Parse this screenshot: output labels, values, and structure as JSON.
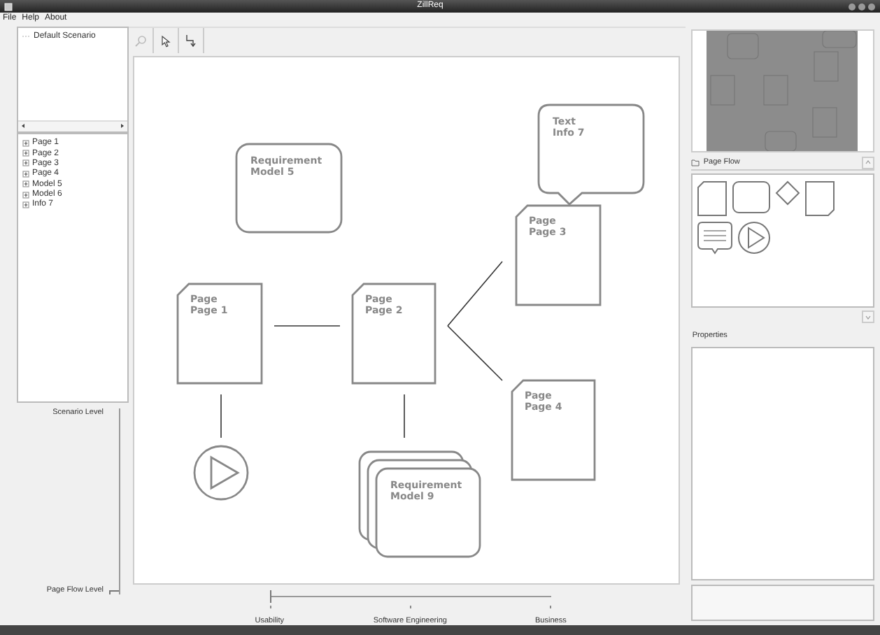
{
  "window": {
    "title": "ZillReq"
  },
  "menu": [
    "File",
    "Help",
    "About"
  ],
  "scenarios": [
    "Default Scenario"
  ],
  "items": [
    "Page 1",
    "Page 2",
    "Page 3",
    "Page 4",
    "Model 5",
    "Model 6",
    "Info 7"
  ],
  "level_slider": {
    "top_label": "Scenario Level",
    "bottom_label": "Page Flow Level",
    "level": 0
  },
  "canvas": {
    "nodes": [
      {
        "kind": "requirement",
        "type": "Requirement",
        "name": "Model 5"
      },
      {
        "kind": "text",
        "type": "Text",
        "name": "Info 7"
      },
      {
        "kind": "page",
        "type": "Page",
        "name": "Page 3"
      },
      {
        "kind": "page",
        "type": "Page",
        "name": "Page 1"
      },
      {
        "kind": "page",
        "type": "Page",
        "name": "Page 2"
      },
      {
        "kind": "page",
        "type": "Page",
        "name": "Page 4"
      },
      {
        "kind": "start"
      },
      {
        "kind": "stack",
        "type": "Requirement",
        "name": "Model 9"
      }
    ]
  },
  "focus_slider": {
    "labels": [
      "Usability",
      "Software Engineering",
      "Business"
    ],
    "level": 0
  },
  "palette": {
    "title": "Page Flow"
  },
  "properties": {
    "title": "Properties"
  }
}
